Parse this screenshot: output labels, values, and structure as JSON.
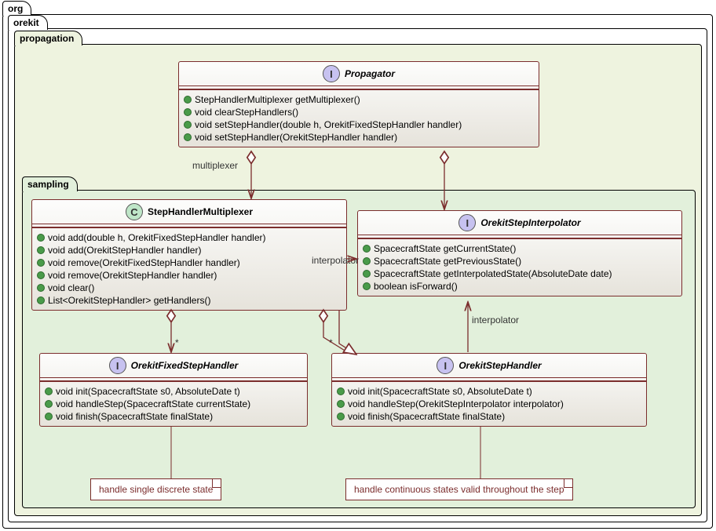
{
  "packages": {
    "org": "org",
    "orekit": "orekit",
    "propagation": "propagation",
    "sampling": "sampling"
  },
  "classes": {
    "Propagator": {
      "name": "Propagator",
      "badge": "I",
      "methods": [
        "StepHandlerMultiplexer getMultiplexer()",
        "void clearStepHandlers()",
        "void setStepHandler(double h, OrekitFixedStepHandler handler)",
        "void setStepHandler(OrekitStepHandler handler)"
      ]
    },
    "StepHandlerMultiplexer": {
      "name": "StepHandlerMultiplexer",
      "badge": "C",
      "methods": [
        "void add(double h, OrekitFixedStepHandler handler)",
        "void add(OrekitStepHandler handler)",
        "void remove(OrekitFixedStepHandler handler)",
        "void remove(OrekitStepHandler handler)",
        "void clear()",
        "List<OrekitStepHandler> getHandlers()"
      ]
    },
    "OrekitStepInterpolator": {
      "name": "OrekitStepInterpolator",
      "badge": "I",
      "methods": [
        "SpacecraftState getCurrentState()",
        "SpacecraftState getPreviousState()",
        "SpacecraftState getInterpolatedState(AbsoluteDate date)",
        "boolean isForward()"
      ]
    },
    "OrekitFixedStepHandler": {
      "name": "OrekitFixedStepHandler",
      "badge": "I",
      "methods": [
        "void init(SpacecraftState s0, AbsoluteDate t)",
        "void handleStep(SpacecraftState currentState)",
        "void finish(SpacecraftState finalState)"
      ]
    },
    "OrekitStepHandler": {
      "name": "OrekitStepHandler",
      "badge": "I",
      "methods": [
        "void init(SpacecraftState s0, AbsoluteDate t)",
        "void handleStep(OrekitStepInterpolator interpolator)",
        "void finish(SpacecraftState finalState)"
      ]
    }
  },
  "labels": {
    "multiplexer": "multiplexer",
    "interpolator1": "interpolator",
    "interpolator2": "interpolator",
    "star1": "*",
    "star2": "*"
  },
  "notes": {
    "fixed": "handle single discrete state",
    "step": "handle continuous states valid throughout the step"
  }
}
